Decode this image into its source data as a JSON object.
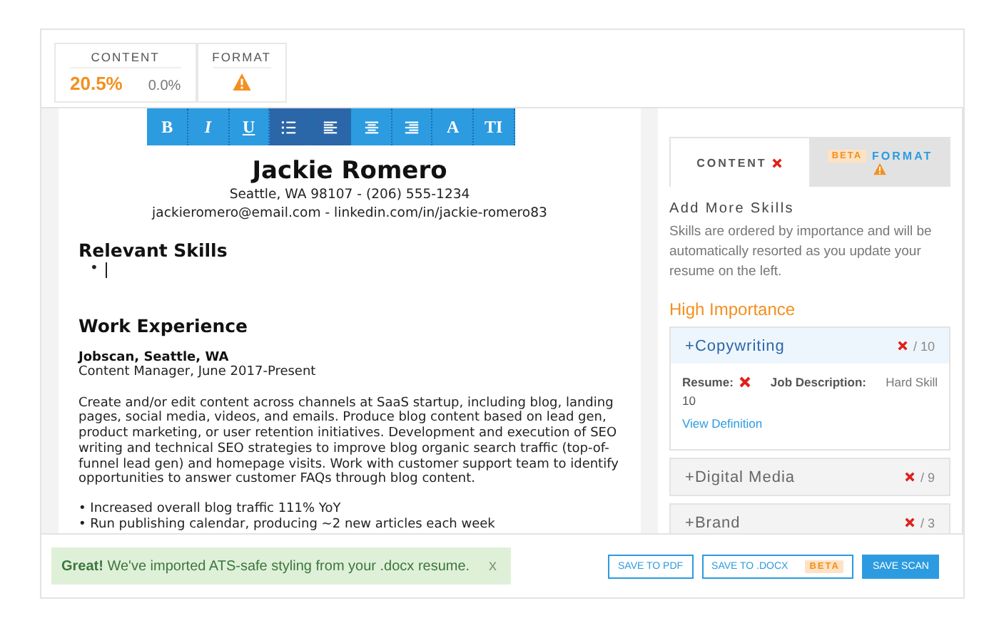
{
  "scores": {
    "content": {
      "label": "CONTENT",
      "value": "20.5%",
      "secondary": "0.0%"
    },
    "format": {
      "label": "FORMAT",
      "warning": true
    }
  },
  "toolbar": [
    {
      "kind": "bold",
      "label": "B",
      "selected": false
    },
    {
      "kind": "italic",
      "label": "I",
      "selected": false
    },
    {
      "kind": "underline",
      "label": "U",
      "selected": false
    },
    {
      "kind": "list",
      "selected": true
    },
    {
      "kind": "left",
      "selected": true
    },
    {
      "kind": "center",
      "selected": false
    },
    {
      "kind": "right",
      "selected": false
    },
    {
      "kind": "text",
      "label": "A",
      "selected": false
    },
    {
      "kind": "text",
      "label": "TI",
      "selected": false
    }
  ],
  "resume": {
    "name": "Jackie Romero",
    "contact": [
      "Seattle, WA 98107 - (206) 555-1234",
      "jackieromero@email.com - linkedin.com/in/jackie-romero83"
    ],
    "sections": [
      {
        "heading": "Relevant Skills",
        "kind": "empty-bullet",
        "marker": "•"
      },
      {
        "heading": "Work Experience",
        "kind": "job",
        "company": "Jobscan, Seattle, WA",
        "role": "Content Manager, June 2017-Present",
        "description": "Create and/or edit content across channels at SaaS startup, including blog, landing pages, social media, videos, and emails. Produce blog content based on lead gen, product marketing, or user retention initiatives. Development and execution of SEO writing and technical SEO strategies to improve blog organic search traffic (top-of-funnel lead gen) and homepage visits. Work with customer support team to identify opportunities to answer customer FAQs through blog content.",
        "bullets": [
          "• Increased overall blog traffic 111% YoY",
          "• Run publishing calendar, producing ~2 new articles each week"
        ]
      }
    ]
  },
  "panel": {
    "tabs": [
      {
        "label": "CONTENT",
        "selected": true,
        "error": true
      },
      {
        "label": "FORMAT",
        "selected": false,
        "badge": "BETA",
        "warning": true
      }
    ],
    "title": "Add More Skills",
    "description": "Skills are ordered by importance and will be automatically resorted as you update your resume on the left.",
    "group": "High Importance",
    "skills": [
      {
        "toggle": "+",
        "name": "Copywriting",
        "expanded": true,
        "found": false,
        "count": "/ 10",
        "resume_label": "Resume:",
        "jd_label": "Job Description:",
        "type": "Hard Skill",
        "jd_count": "10",
        "link": "View Definition"
      },
      {
        "toggle": "+",
        "name": "Digital Media",
        "expanded": false,
        "found": false,
        "count": "/ 9"
      },
      {
        "toggle": "+",
        "name": "Brand",
        "expanded": false,
        "found": false,
        "count": "/ 3"
      }
    ]
  },
  "toast": {
    "strong": "Great!",
    "message": "We've imported ATS-safe styling from your .docx resume.",
    "close": "x"
  },
  "buttons": [
    {
      "label": "SAVE TO PDF",
      "kind": "outline"
    },
    {
      "label": "SAVE TO .DOCX",
      "kind": "outline",
      "badge": "BETA"
    },
    {
      "label": "SAVE SCAN",
      "kind": "primary"
    }
  ]
}
